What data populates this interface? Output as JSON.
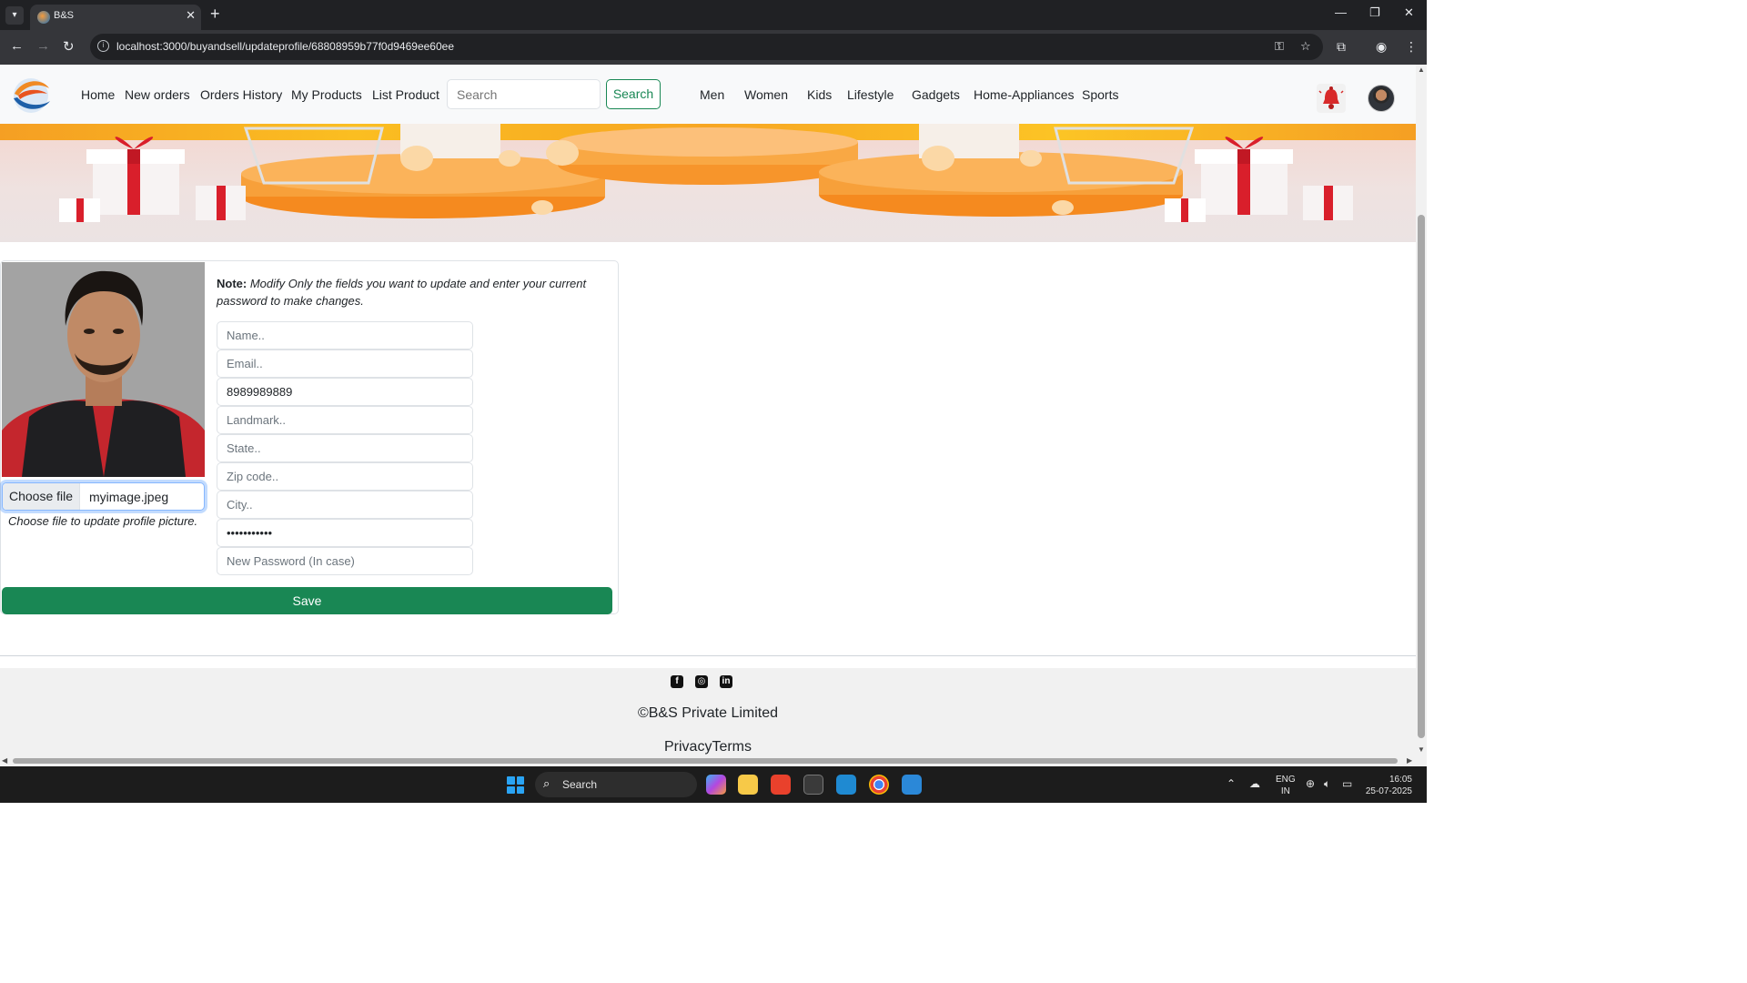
{
  "browser": {
    "tab_title": "B&S",
    "url": "localhost:3000/buyandsell/updateprofile/68808959b77f0d9469ee60ee"
  },
  "navbar": {
    "links": [
      "Home",
      "New orders",
      "Orders History",
      "My Products",
      "List Product"
    ],
    "search_placeholder": "Search",
    "search_button": "Search",
    "categories": [
      "Men",
      "Women",
      "Kids",
      "Lifestyle",
      "Gadgets",
      "Home-Appliances",
      "Sports"
    ]
  },
  "profile": {
    "file_button": "Choose file",
    "file_name": "myimage.jpeg",
    "file_hint": "Choose file to update profile picture.",
    "note_label": "Note:",
    "note_text": " Modify Only the fields you want to update and enter your current password to make changes.",
    "fields": {
      "name_placeholder": "Name..",
      "email_placeholder": "Email..",
      "phone_value": "8989989889",
      "landmark_placeholder": "Landmark..",
      "state_placeholder": "State..",
      "zip_placeholder": "Zip code..",
      "city_placeholder": "City..",
      "current_password_value": "•••••••••••",
      "new_password_placeholder": "New Password (In case)"
    },
    "save_button": "Save"
  },
  "footer": {
    "copyright": "©B&S Private Limited",
    "links": "PrivacyTerms",
    "social_icons": [
      "facebook-icon",
      "instagram-icon",
      "linkedin-icon"
    ]
  },
  "taskbar": {
    "search_text": "Search",
    "lang_line1": "ENG",
    "lang_line2": "IN",
    "time": "16:05",
    "date": "25-07-2025"
  },
  "colors": {
    "brand_green": "#198754",
    "focus_blue": "#86b7fe",
    "banner_orange": "#f7931e"
  }
}
